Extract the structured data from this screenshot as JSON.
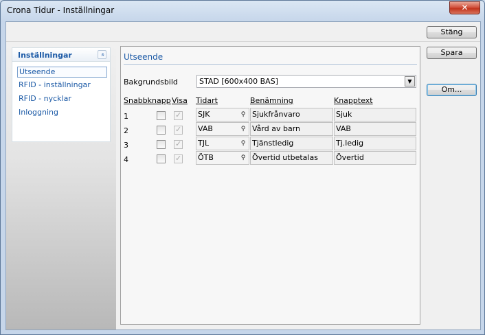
{
  "window": {
    "title": "Crona Tidur - Inställningar",
    "close_glyph": "✕"
  },
  "toolbar": {
    "close_label": "Stäng",
    "save_label": "Spara",
    "about_label": "Om..."
  },
  "sidebar": {
    "header": "Inställningar",
    "collapse_glyph": "«",
    "items": [
      {
        "label": "Utseende",
        "selected": true
      },
      {
        "label": "RFID - inställningar"
      },
      {
        "label": "RFID - nycklar"
      },
      {
        "label": "Inloggning"
      }
    ]
  },
  "main": {
    "section_title": "Utseende",
    "background_label": "Bakgrundsbild",
    "background_value": "STAD  [600x400 BAS]",
    "columns": {
      "shortcut": "Snabbknapp",
      "show": "Visa",
      "timetype": "Tidart",
      "name": "Benämning",
      "button_text": "Knapptext"
    },
    "rows": [
      {
        "num": "1",
        "code": "SJK",
        "name": "Sjukfrånvaro",
        "button_text": "Sjuk"
      },
      {
        "num": "2",
        "code": "VAB",
        "name": "Vård av barn",
        "button_text": "VAB"
      },
      {
        "num": "3",
        "code": "TJL",
        "name": "Tjänstledig",
        "button_text": "Tj.ledig"
      },
      {
        "num": "4",
        "code": "ÖTB",
        "name": "Övertid utbetalas",
        "button_text": "Övertid"
      }
    ],
    "check_glyph": "✓",
    "lookup_glyph": "⚲",
    "dropdown_glyph": "▼"
  }
}
